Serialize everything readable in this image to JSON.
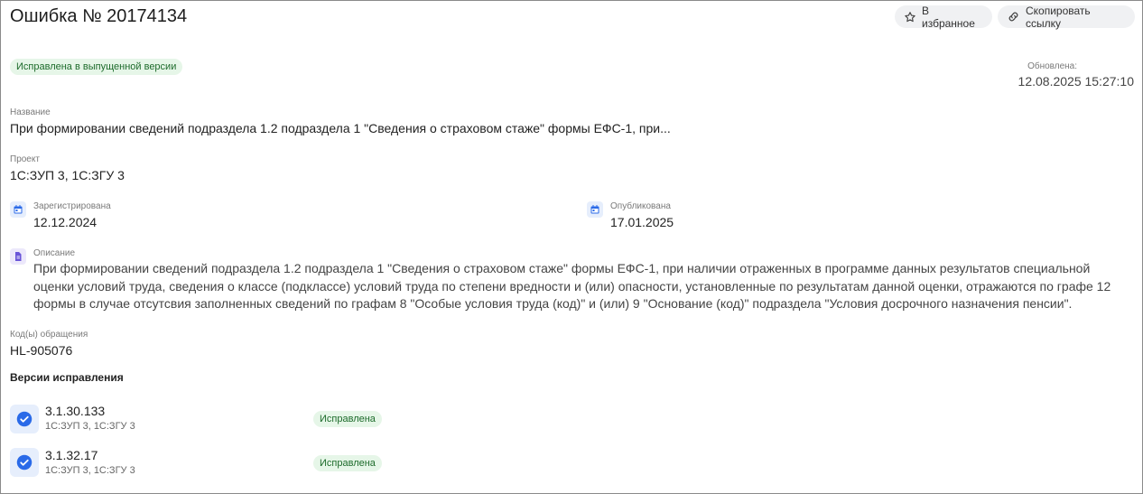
{
  "header": {
    "title": "Ошибка № 20174134",
    "favorite_label": "В избранное",
    "copy_link_label": "Скопировать ссылку"
  },
  "status_badge": "Исправлена в выпущенной версии",
  "updated": {
    "label": "Обновлена:",
    "value": "12.08.2025 15:27:10"
  },
  "name": {
    "label": "Название",
    "value": "При формировании сведений подраздела 1.2 подраздела 1 \"Сведения о страховом стаже\" формы ЕФС-1, при..."
  },
  "project": {
    "label": "Проект",
    "value": "1С:ЗУП 3, 1С:ЗГУ 3"
  },
  "registered": {
    "label": "Зарегистрирована",
    "value": "12.12.2024"
  },
  "published": {
    "label": "Опубликована",
    "value": "17.01.2025"
  },
  "description": {
    "label": "Описание",
    "value": "При формировании сведений подраздела 1.2 подраздела 1 \"Сведения о страховом стаже\" формы ЕФС-1, при наличии отраженных в программе данных результатов специальной оценки условий труда, сведения о классе (подклассе) условий труда по степени вредности и (или) опасности, установленные по результатам данной оценки, отражаются по графе 12 формы в случае отсутсвия заполненных сведений по графам 8 \"Особые условия труда (код)\" и (или) 9 \"Основание (код)\" подраздела \"Условия досрочного назначения пенсии\"."
  },
  "appeal_codes": {
    "label": "Код(ы) обращения",
    "value": "HL-905076"
  },
  "versions": {
    "heading": "Версии исправления",
    "items": [
      {
        "number": "3.1.30.133",
        "project": "1С:ЗУП 3, 1С:ЗГУ 3",
        "status": "Исправлена"
      },
      {
        "number": "3.1.32.17",
        "project": "1С:ЗУП 3, 1С:ЗГУ 3",
        "status": "Исправлена"
      }
    ]
  },
  "icons": {
    "favorite": "star-icon",
    "copy_link": "link-icon",
    "registered": "calendar-icon",
    "published": "calendar-icon",
    "description": "document-icon",
    "version_check": "check-circle-icon"
  },
  "colors": {
    "accent": "#2a6ae8",
    "badge_bg": "#e6f6e8",
    "badge_text": "#1d6b2b"
  }
}
